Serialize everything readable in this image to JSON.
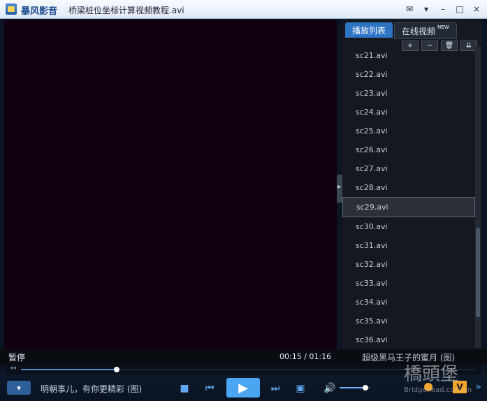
{
  "app": {
    "name": "暴风影音",
    "file_title": "桥梁桩位坐标计算视频教程.avi"
  },
  "playlist": {
    "tabs": [
      "播放列表",
      "在线视频"
    ],
    "new_badge": "NEW",
    "toolbar": [
      "+",
      "−",
      "🗑",
      "⇊"
    ],
    "items": [
      "sc21.avi",
      "sc22.avi",
      "sc23.avi",
      "sc24.avi",
      "sc25.avi",
      "sc26.avi",
      "sc27.avi",
      "sc28.avi",
      "sc29.avi",
      "sc30.avi",
      "sc31.avi",
      "sc32.avi",
      "sc33.avi",
      "sc34.avi",
      "sc35.avi",
      "sc36.avi"
    ],
    "selected_index": 8
  },
  "status": {
    "state": "暂停",
    "time": "00:15 / 01:16",
    "promo_right": "超级黑马王子的蜜月 (图)"
  },
  "controls": {
    "promo": "明朝事儿，有你更精彩 (图)",
    "seek_fraction": 0.21,
    "volume_fraction": 0.85
  },
  "watermark": {
    "text": "橋頭堡",
    "sub": "Bridgehead.com.cn"
  }
}
